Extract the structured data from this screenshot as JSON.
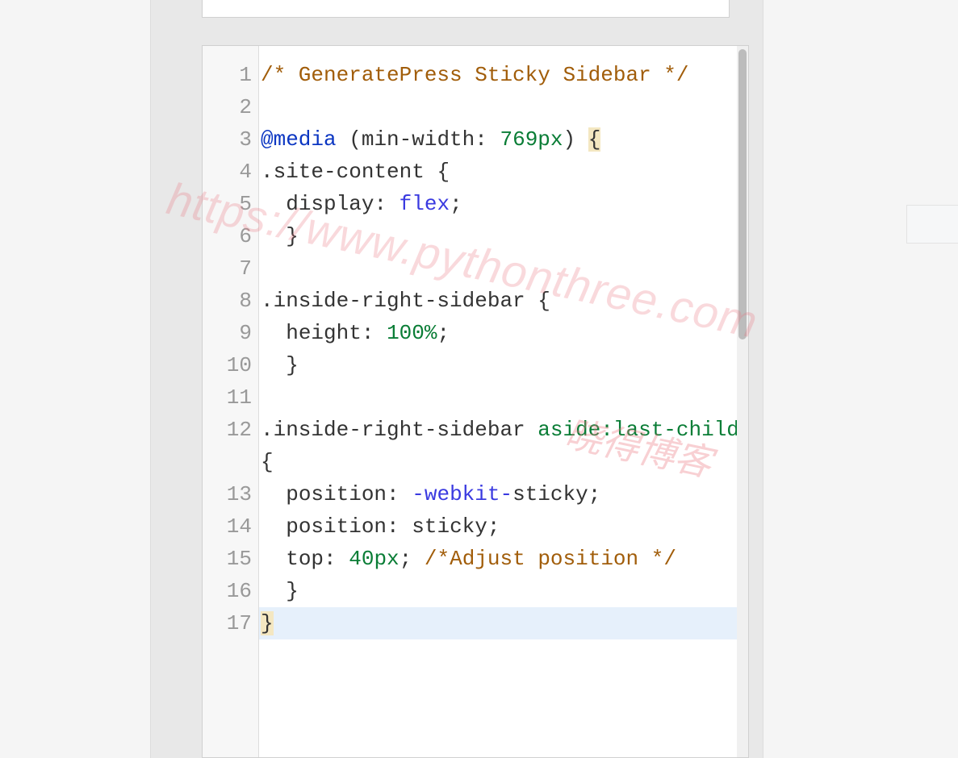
{
  "watermarks": {
    "url": "https://www.pythonthree.com",
    "chinese": "晓得博客"
  },
  "code": {
    "lines": [
      {
        "n": 1,
        "tokens": [
          {
            "cls": "tok-comment",
            "t": "/* GeneratePress Sticky Sidebar */"
          }
        ]
      },
      {
        "n": 2,
        "tokens": []
      },
      {
        "n": 3,
        "tokens": [
          {
            "cls": "tok-at",
            "t": "@media"
          },
          {
            "cls": "tok-punct",
            "t": " ("
          },
          {
            "cls": "tok-prop",
            "t": "min-width"
          },
          {
            "cls": "tok-punct",
            "t": ": "
          },
          {
            "cls": "tok-num",
            "t": "769px"
          },
          {
            "cls": "tok-punct",
            "t": ") "
          },
          {
            "cls": "tok-punct brace-hl",
            "t": "{"
          }
        ]
      },
      {
        "n": 4,
        "tokens": [
          {
            "cls": "tok-sel",
            "t": ".site-content "
          },
          {
            "cls": "tok-punct",
            "t": "{"
          }
        ]
      },
      {
        "n": 5,
        "tokens": [
          {
            "cls": "",
            "t": "  "
          },
          {
            "cls": "tok-prop",
            "t": "display"
          },
          {
            "cls": "tok-punct",
            "t": ": "
          },
          {
            "cls": "tok-val",
            "t": "flex"
          },
          {
            "cls": "tok-punct",
            "t": ";"
          }
        ]
      },
      {
        "n": 6,
        "tokens": [
          {
            "cls": "",
            "t": "  "
          },
          {
            "cls": "tok-punct",
            "t": "}"
          }
        ]
      },
      {
        "n": 7,
        "tokens": []
      },
      {
        "n": 8,
        "tokens": [
          {
            "cls": "tok-sel",
            "t": ".inside-right-sidebar "
          },
          {
            "cls": "tok-punct",
            "t": "{"
          }
        ]
      },
      {
        "n": 9,
        "tokens": [
          {
            "cls": "",
            "t": "  "
          },
          {
            "cls": "tok-prop",
            "t": "height"
          },
          {
            "cls": "tok-punct",
            "t": ": "
          },
          {
            "cls": "tok-num",
            "t": "100%"
          },
          {
            "cls": "tok-punct",
            "t": ";"
          }
        ]
      },
      {
        "n": 10,
        "tokens": [
          {
            "cls": "",
            "t": "  "
          },
          {
            "cls": "tok-punct",
            "t": "}"
          }
        ]
      },
      {
        "n": 11,
        "tokens": []
      },
      {
        "n": 12,
        "tokens": [
          {
            "cls": "tok-sel",
            "t": ".inside-right-sidebar "
          },
          {
            "cls": "tok-pseudo",
            "t": "aside:last-child "
          },
          {
            "cls": "tok-punct",
            "t": "{"
          }
        ]
      },
      {
        "n": 13,
        "tokens": [
          {
            "cls": "",
            "t": "  "
          },
          {
            "cls": "tok-prop",
            "t": "position"
          },
          {
            "cls": "tok-punct",
            "t": ": "
          },
          {
            "cls": "tok-val",
            "t": "-webkit-"
          },
          {
            "cls": "tok-kw",
            "t": "sticky"
          },
          {
            "cls": "tok-punct",
            "t": ";"
          }
        ]
      },
      {
        "n": 14,
        "tokens": [
          {
            "cls": "",
            "t": "  "
          },
          {
            "cls": "tok-prop",
            "t": "position"
          },
          {
            "cls": "tok-punct",
            "t": ": "
          },
          {
            "cls": "tok-kw",
            "t": "sticky"
          },
          {
            "cls": "tok-punct",
            "t": ";"
          }
        ]
      },
      {
        "n": 15,
        "tokens": [
          {
            "cls": "",
            "t": "  "
          },
          {
            "cls": "tok-prop",
            "t": "top"
          },
          {
            "cls": "tok-punct",
            "t": ": "
          },
          {
            "cls": "tok-num",
            "t": "40px"
          },
          {
            "cls": "tok-punct",
            "t": "; "
          },
          {
            "cls": "tok-comment",
            "t": "/*Adjust position */"
          }
        ]
      },
      {
        "n": 16,
        "tokens": [
          {
            "cls": "",
            "t": "  "
          },
          {
            "cls": "tok-punct",
            "t": "}"
          }
        ]
      },
      {
        "n": 17,
        "current": true,
        "tokens": [
          {
            "cls": "tok-punct brace-hl",
            "t": "}"
          }
        ]
      }
    ]
  }
}
